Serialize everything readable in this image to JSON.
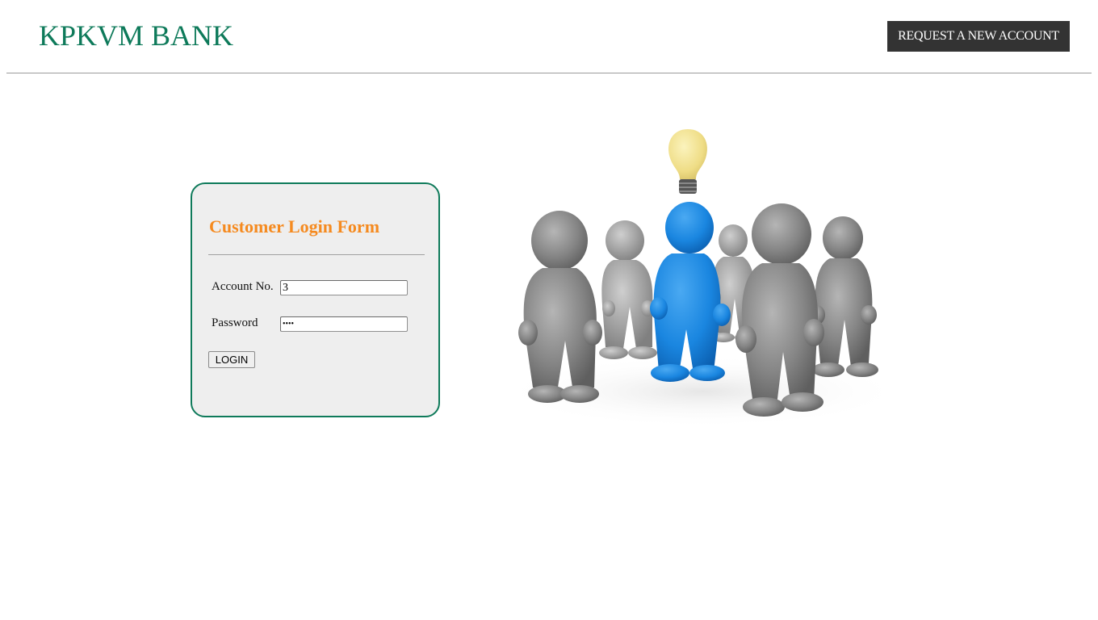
{
  "header": {
    "logo_text": "KPKVM BANK",
    "request_button_label": "REQUEST A NEW ACCOUNT"
  },
  "login_form": {
    "title": "Customer Login Form",
    "account_label": "Account No.",
    "account_value": "3",
    "password_label": "Password",
    "password_value": "••••",
    "login_button_label": "LOGIN"
  },
  "illustration": {
    "icon": "team-idea-illustration",
    "highlight_color": "#1e88e5",
    "figure_color": "#7d7d7d",
    "bulb_color": "#f0e08a"
  },
  "colors": {
    "brand": "#0e7a5a",
    "title_accent": "#f58a1f",
    "button_dark": "#333333"
  }
}
